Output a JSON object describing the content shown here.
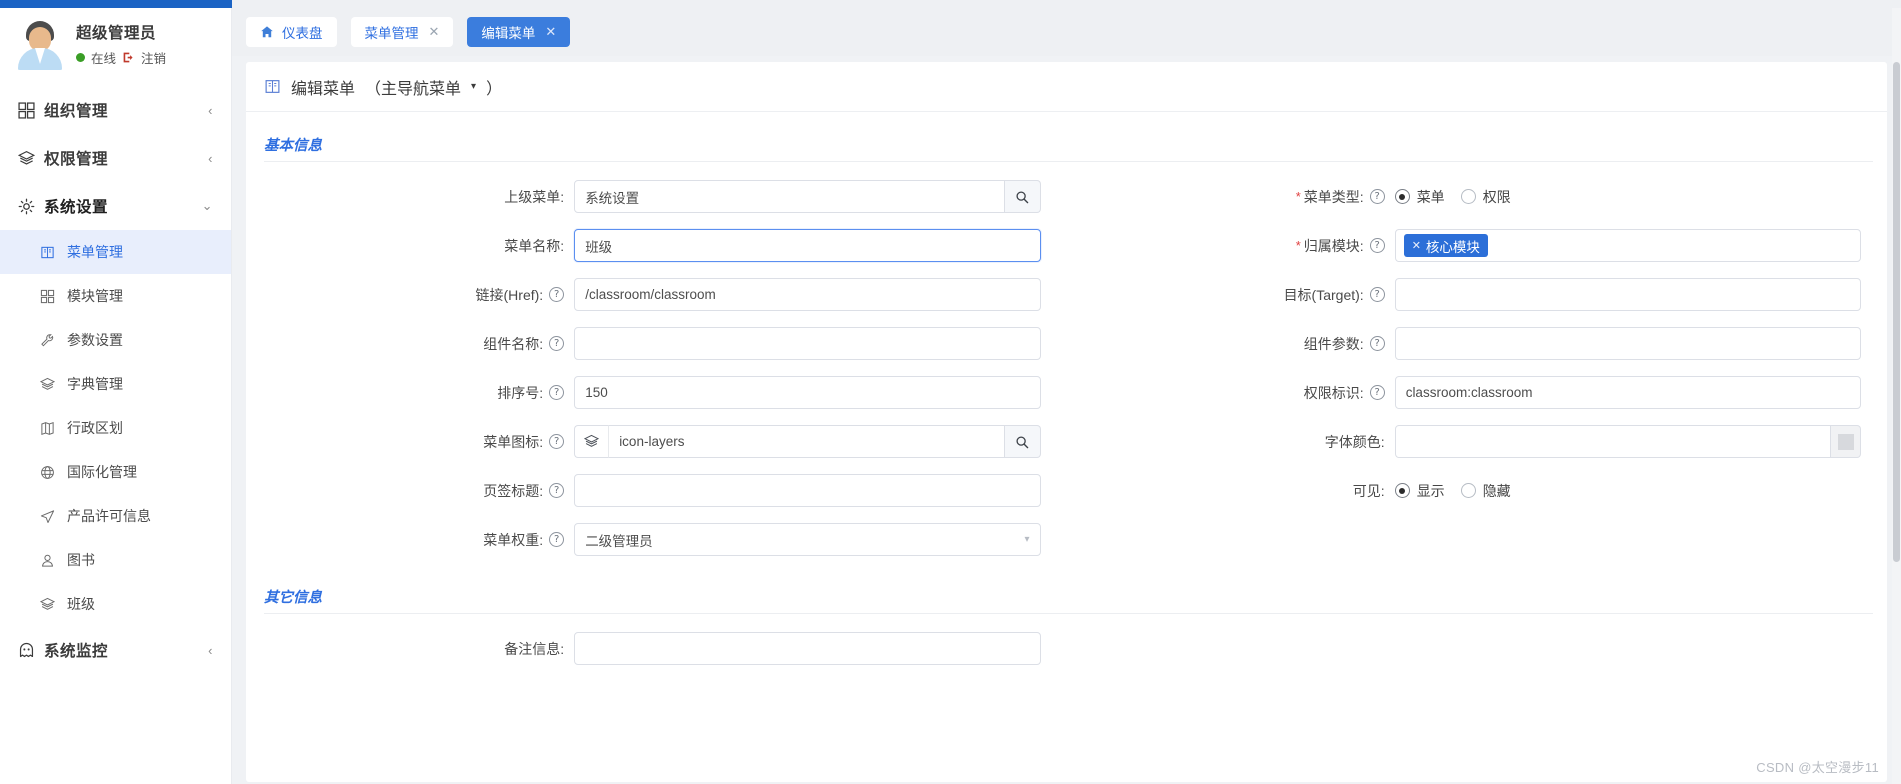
{
  "user": {
    "name": "超级管理员",
    "status_label": "在线",
    "logout_label": "注销"
  },
  "sidebar": {
    "groups": [
      {
        "icon": "grid-icon",
        "label": "组织管理",
        "chevron": "‹",
        "expanded": false
      },
      {
        "icon": "layers-icon",
        "label": "权限管理",
        "chevron": "‹",
        "expanded": false
      },
      {
        "icon": "gear-icon",
        "label": "系统设置",
        "chevron": "⌄",
        "expanded": true
      },
      {
        "icon": "ghost-icon",
        "label": "系统监控",
        "chevron": "‹",
        "expanded": false
      }
    ],
    "system_settings_items": [
      {
        "icon": "book-icon",
        "label": "菜单管理",
        "selected": true
      },
      {
        "icon": "grid-icon",
        "label": "模块管理",
        "selected": false
      },
      {
        "icon": "wrench-icon",
        "label": "参数设置",
        "selected": false
      },
      {
        "icon": "layers-icon",
        "label": "字典管理",
        "selected": false
      },
      {
        "icon": "map-icon",
        "label": "行政区划",
        "selected": false
      },
      {
        "icon": "globe-icon",
        "label": "国际化管理",
        "selected": false
      },
      {
        "icon": "send-icon",
        "label": "产品许可信息",
        "selected": false
      },
      {
        "icon": "user-icon",
        "label": "图书",
        "selected": false
      },
      {
        "icon": "layers-icon",
        "label": "班级",
        "selected": false
      }
    ]
  },
  "tabs": [
    {
      "label": "仪表盘",
      "icon": "home-icon",
      "closable": false,
      "active": false
    },
    {
      "label": "菜单管理",
      "icon": "",
      "closable": true,
      "active": false
    },
    {
      "label": "编辑菜单",
      "icon": "",
      "closable": true,
      "active": true
    }
  ],
  "page": {
    "title": "编辑菜单",
    "subtitle": "（主导航菜单",
    "subtitle_caret": "▾",
    "subtitle_tail": "）",
    "icon": "book-icon"
  },
  "sections": {
    "basic": "基本信息",
    "other": "其它信息"
  },
  "form": {
    "left": [
      {
        "label": "上级菜单:",
        "required": false,
        "help": false,
        "type": "input-search",
        "value": "系统设置",
        "placeholder": "",
        "addon_icon": "search-icon"
      },
      {
        "label": "菜单名称:",
        "required": false,
        "help": false,
        "type": "input",
        "value": "班级",
        "placeholder": "",
        "focused": true
      },
      {
        "label": "链接(Href):",
        "required": false,
        "help": true,
        "type": "input",
        "value": "/classroom/classroom",
        "placeholder": ""
      },
      {
        "label": "组件名称:",
        "required": false,
        "help": true,
        "type": "input",
        "value": "",
        "placeholder": ""
      },
      {
        "label": "排序号:",
        "required": false,
        "help": true,
        "type": "input",
        "value": "150",
        "placeholder": ""
      },
      {
        "label": "菜单图标:",
        "required": false,
        "help": true,
        "type": "input-icon-search",
        "value": "icon-layers",
        "placeholder": "",
        "prefix_icon": "layers-icon",
        "addon_icon": "search-icon"
      },
      {
        "label": "页签标题:",
        "required": false,
        "help": true,
        "type": "input",
        "value": "",
        "placeholder": ""
      },
      {
        "label": "菜单权重:",
        "required": false,
        "help": true,
        "type": "select",
        "value": "二级管理员",
        "arrow": "▾"
      }
    ],
    "right": [
      {
        "label": "菜单类型:",
        "required": true,
        "help": true,
        "type": "radio",
        "options": [
          {
            "label": "菜单",
            "checked": true
          },
          {
            "label": "权限",
            "checked": false
          }
        ]
      },
      {
        "label": "归属模块:",
        "required": true,
        "help": true,
        "type": "tags",
        "tags": [
          {
            "label": "核心模块",
            "remove": "✕"
          }
        ]
      },
      {
        "label": "目标(Target):",
        "required": false,
        "help": true,
        "type": "input",
        "value": "",
        "placeholder": ""
      },
      {
        "label": "组件参数:",
        "required": false,
        "help": true,
        "type": "input",
        "value": "",
        "placeholder": ""
      },
      {
        "label": "权限标识:",
        "required": false,
        "help": true,
        "type": "input",
        "value": "classroom:classroom",
        "placeholder": ""
      },
      {
        "label": "字体颜色:",
        "required": false,
        "help": false,
        "type": "color",
        "value": "",
        "placeholder": ""
      },
      {
        "label": "可见:",
        "required": false,
        "help": false,
        "type": "radio",
        "options": [
          {
            "label": "显示",
            "checked": true
          },
          {
            "label": "隐藏",
            "checked": false
          }
        ]
      }
    ],
    "other_first_label": "备注信息:"
  },
  "watermark": "CSDN @太空漫步11",
  "colors": {
    "accent": "#2f6fe0",
    "tab_active": "#3b7ddd",
    "tag": "#2c6fd8",
    "required": "#e04040",
    "online": "#3a9e26",
    "top_strip": "#1b63c4"
  }
}
